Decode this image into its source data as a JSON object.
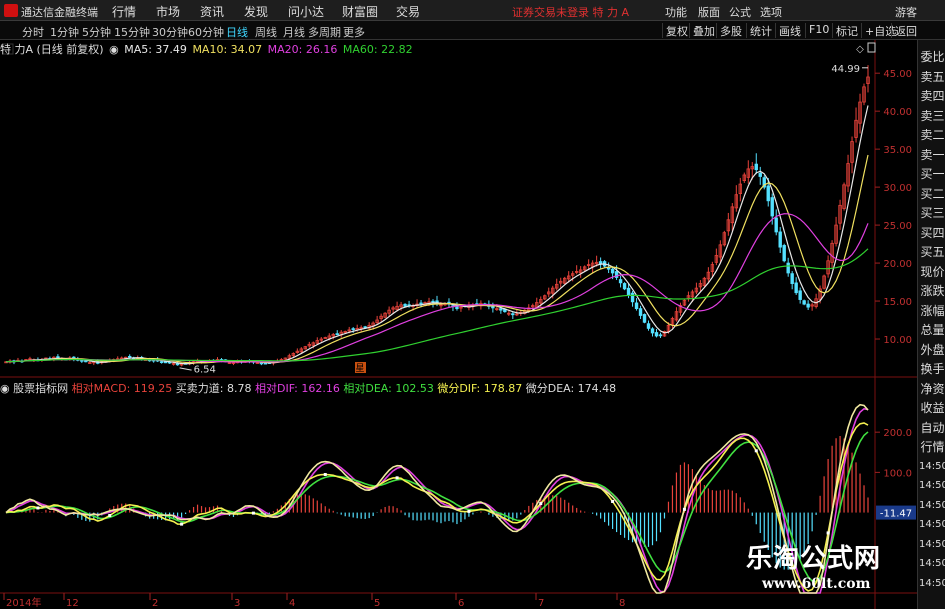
{
  "app": {
    "name": "通达信金融终端"
  },
  "menu": [
    "行情",
    "市场",
    "资讯",
    "发现",
    "问小达",
    "财富圈",
    "交易"
  ],
  "notice": "证券交易未登录 特 力 A",
  "right_menu": [
    "功能",
    "版面",
    "公式",
    "选项"
  ],
  "login": "游客",
  "timeframes": [
    "分时",
    "1分钟",
    "5分钟",
    "15分钟",
    "30分钟",
    "60分钟",
    "日线",
    "周线",
    "月线",
    "多周期",
    "更多"
  ],
  "active_timeframe": "日线",
  "toolbar_buttons": [
    "复权",
    "叠加",
    "多股",
    "统计",
    "画线",
    "F10",
    "标记",
    "+自选",
    "返回"
  ],
  "price_info": {
    "name": "特 力A (日线 前复权)",
    "ma5": "MA5: 37.49",
    "ma10": "MA10: 34.07",
    "ma20": "MA20: 26.16",
    "ma60": "MA60: 22.82"
  },
  "indicator_info": {
    "name": "股票指标网",
    "macd": "相对MACD: 119.25",
    "power": "买卖力道: 8.78",
    "dif": "相对DIF: 162.16",
    "dea": "相对DEA: 102.53",
    "wdif": "微分DIF: 178.87",
    "wdea": "微分DEA: 174.48"
  },
  "price_axis": [
    "45.00",
    "40.00",
    "35.00",
    "30.00",
    "25.00",
    "20.00",
    "15.00",
    "10.00"
  ],
  "indicator_axis": [
    "200.0",
    "100.0"
  ],
  "right_badge": "-11.47",
  "max_label": "44.99",
  "min_label": "6.54",
  "event_marker": "星",
  "time_axis": [
    "2014年",
    "12",
    "2",
    "3",
    "4",
    "5",
    "6",
    "7",
    "8"
  ],
  "right_panel": [
    "委比",
    "卖五",
    "卖四",
    "卖三",
    "卖二",
    "卖一",
    "买一",
    "买二",
    "买三",
    "买四",
    "买五",
    "现价",
    "涨跌",
    "涨幅",
    "总量",
    "外盘",
    "换手",
    "净资",
    "收益",
    "自动",
    "行情",
    "14:50",
    "14:50",
    "14:50",
    "14:50",
    "14:50",
    "14:50",
    "14:50"
  ],
  "watermark": {
    "title": "乐淘公式网",
    "url": "www.60lt.com"
  },
  "colors": {
    "up": "#e8433b",
    "down": "#54e0ff",
    "ma5": "#e8e8e8",
    "ma10": "#f0e060",
    "ma20": "#e040e0",
    "ma60": "#30d030",
    "dif": "#f4f050",
    "dea": "#40e040",
    "wdea": "#e040e0"
  },
  "chart_data": [
    {
      "type": "candlestick",
      "title": "特 力A (日线 前复权)",
      "ylim": [
        5,
        47
      ],
      "y_ticks": [
        10,
        15,
        20,
        25,
        30,
        35,
        40,
        45
      ],
      "x_ticks": [
        "2014年",
        "12",
        "2",
        "3",
        "4",
        "5",
        "6",
        "7",
        "8"
      ],
      "close": [
        7.0,
        7.1,
        7.0,
        7.2,
        7.1,
        7.3,
        7.4,
        7.3,
        7.2,
        7.3,
        7.5,
        7.4,
        7.6,
        7.5,
        7.4,
        7.3,
        7.5,
        7.4,
        7.2,
        7.1,
        7.0,
        6.9,
        7.0,
        6.8,
        7.0,
        7.1,
        7.2,
        7.3,
        7.4,
        7.5,
        7.6,
        7.6,
        7.5,
        7.5,
        7.4,
        7.3,
        7.2,
        7.2,
        7.1,
        7.0,
        6.9,
        6.9,
        6.8,
        6.6,
        6.7,
        6.8,
        6.9,
        7.0,
        7.1,
        7.0,
        7.0,
        7.1,
        7.2,
        7.3,
        7.2,
        7.0,
        6.9,
        6.9,
        7.0,
        7.0,
        7.1,
        7.0,
        7.0,
        6.9,
        6.8,
        6.8,
        6.9,
        7.0,
        7.1,
        7.3,
        7.5,
        7.8,
        8.1,
        8.4,
        8.7,
        9.0,
        9.3,
        9.5,
        9.8,
        10.0,
        10.2,
        10.4,
        10.6,
        10.7,
        10.9,
        11.0,
        11.2,
        11.3,
        11.4,
        11.5,
        11.6,
        11.8,
        12.1,
        12.5,
        13.0,
        13.4,
        13.8,
        14.1,
        14.3,
        14.5,
        14.3,
        14.5,
        14.4,
        14.6,
        14.7,
        14.8,
        14.9,
        14.8,
        14.6,
        14.5,
        14.7,
        14.6,
        14.3,
        14.0,
        14.2,
        14.3,
        14.4,
        14.5,
        14.6,
        14.7,
        14.5,
        14.3,
        14.1,
        14.0,
        13.8,
        13.6,
        13.4,
        13.2,
        13.3,
        13.5,
        13.8,
        14.1,
        14.4,
        14.8,
        15.2,
        15.7,
        16.2,
        16.7,
        17.2,
        17.6,
        18.0,
        18.3,
        18.6,
        18.9,
        19.1,
        19.5,
        19.8,
        20.0,
        20.1,
        19.9,
        19.6,
        19.2,
        18.7,
        18.1,
        17.4,
        16.6,
        15.8,
        14.9,
        14.0,
        13.1,
        12.2,
        11.4,
        10.8,
        10.4,
        10.5,
        11.0,
        11.8,
        12.7,
        13.6,
        14.4,
        15.1,
        15.7,
        16.2,
        16.7,
        17.3,
        18.0,
        18.8,
        19.8,
        21.0,
        22.4,
        24.0,
        25.7,
        27.4,
        29.0,
        30.4,
        31.6,
        32.4,
        32.7,
        32.3,
        31.4,
        30.0,
        28.2,
        26.2,
        24.1,
        22.1,
        20.3,
        18.7,
        17.3,
        16.1,
        15.2,
        14.6,
        14.2,
        14.5,
        15.3,
        16.6,
        18.3,
        20.3,
        22.6,
        25.0,
        27.6,
        30.3,
        33.1,
        36.0,
        38.8,
        41.2,
        43.2,
        44.5
      ]
    },
    {
      "type": "line",
      "title": "股票指标网",
      "ylim": [
        -200,
        280
      ],
      "y_ticks": [
        100,
        200
      ],
      "series": [
        {
          "name": "相对DIF",
          "last": 162.16
        },
        {
          "name": "相对DEA",
          "last": 102.53
        },
        {
          "name": "微分DIF",
          "last": 178.87
        },
        {
          "name": "微分DEA",
          "last": 174.48
        }
      ]
    }
  ]
}
